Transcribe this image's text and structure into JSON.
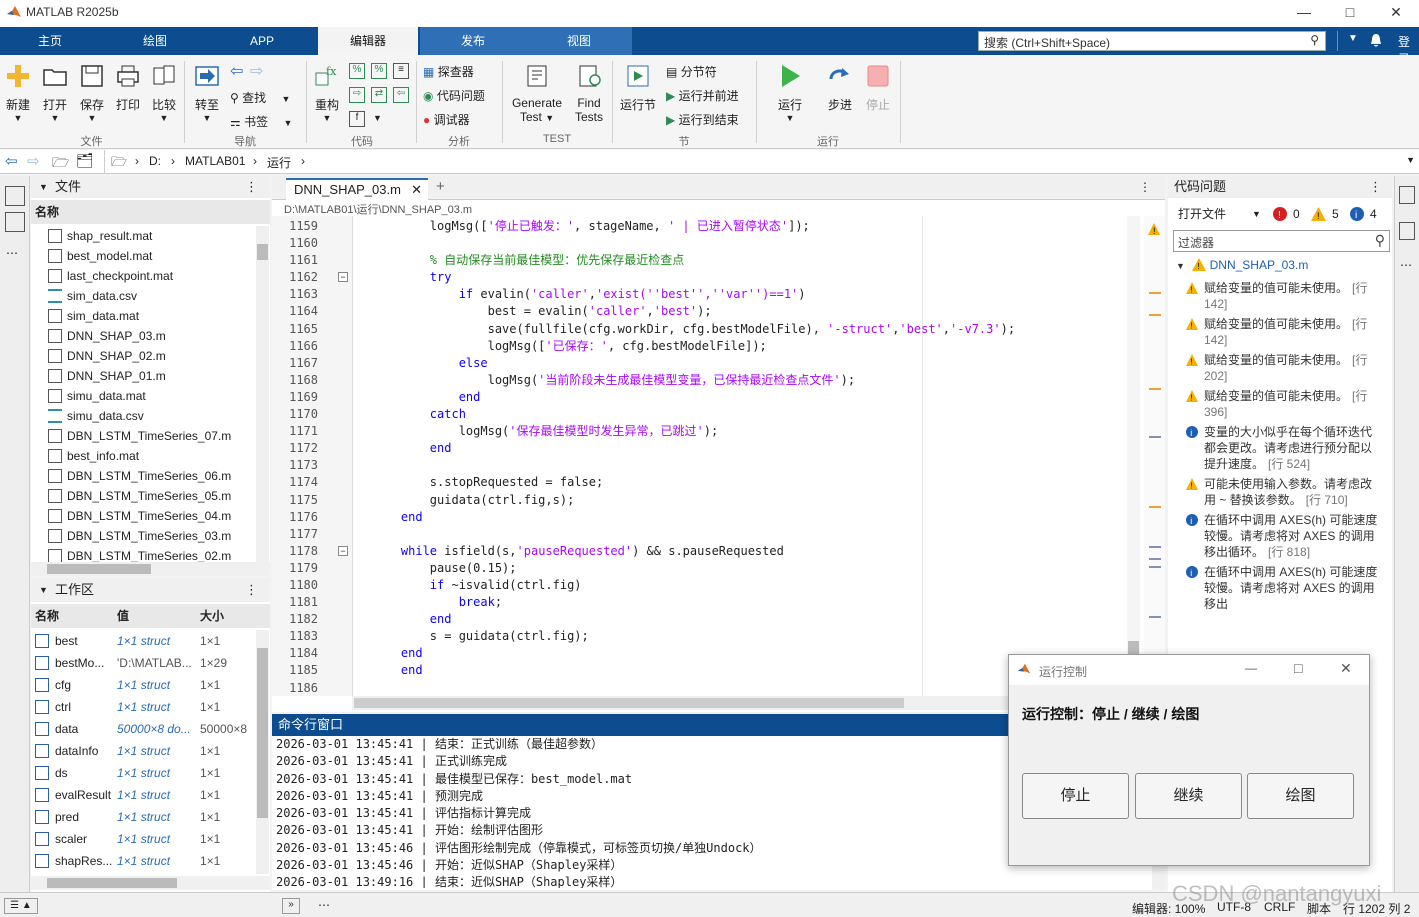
{
  "window": {
    "title": "MATLAB R2025b"
  },
  "tabs": [
    "主页",
    "绘图",
    "APP",
    "编辑器",
    "发布",
    "视图"
  ],
  "search": {
    "placeholder": "搜索 (Ctrl+Shift+Space)"
  },
  "login": "登录",
  "ribbon": {
    "file": {
      "new": "新建",
      "open": "打开",
      "save": "保存",
      "print": "打印",
      "compare": "比较",
      "group": "文件"
    },
    "nav": {
      "goto": "转至",
      "find": "查找",
      "bookmark": "书签",
      "group": "导航"
    },
    "code": {
      "refactor": "重构",
      "group": "代码"
    },
    "analysis": {
      "inspector": "探查器",
      "code_issues": "代码问题",
      "debugger": "调试器",
      "group": "分析"
    },
    "test": {
      "generate": "Generate",
      "generate2": "Test",
      "find": "Find",
      "find2": "Tests",
      "group": "TEST"
    },
    "section": {
      "run_section": "运行节",
      "split": "分节符",
      "run_advance": "运行并前进",
      "run_to_end": "运行到结束",
      "group": "节"
    },
    "run": {
      "run": "运行",
      "step": "步进",
      "stop": "停止",
      "group": "运行"
    }
  },
  "address": {
    "drive": "D:",
    "folder1": "MATLAB01",
    "folder2": "运行"
  },
  "files": {
    "title": "文件",
    "col_name": "名称",
    "items": [
      "shap_result.mat",
      "best_model.mat",
      "last_checkpoint.mat",
      "sim_data.csv",
      "sim_data.mat",
      "DNN_SHAP_03.m",
      "DNN_SHAP_02.m",
      "DNN_SHAP_01.m",
      "simu_data.mat",
      "simu_data.csv",
      "DBN_LSTM_TimeSeries_07.m",
      "best_info.mat",
      "DBN_LSTM_TimeSeries_06.m",
      "DBN_LSTM_TimeSeries_05.m",
      "DBN_LSTM_TimeSeries_04.m",
      "DBN_LSTM_TimeSeries_03.m",
      "DBN_LSTM_TimeSeries_02.m"
    ]
  },
  "workspace": {
    "title": "工作区",
    "col_name": "名称",
    "col_value": "值",
    "col_size": "大小",
    "rows": [
      {
        "name": "best",
        "value": "1×1 struct",
        "size": "1×1"
      },
      {
        "name": "bestMo...",
        "value": "'D:\\MATLAB...",
        "size": "1×29"
      },
      {
        "name": "cfg",
        "value": "1×1 struct",
        "size": "1×1"
      },
      {
        "name": "ctrl",
        "value": "1×1 struct",
        "size": "1×1"
      },
      {
        "name": "data",
        "value": "50000×8 do...",
        "size": "50000×8"
      },
      {
        "name": "dataInfo",
        "value": "1×1 struct",
        "size": "1×1"
      },
      {
        "name": "ds",
        "value": "1×1 struct",
        "size": "1×1"
      },
      {
        "name": "evalResult",
        "value": "1×1 struct",
        "size": "1×1"
      },
      {
        "name": "pred",
        "value": "1×1 struct",
        "size": "1×1"
      },
      {
        "name": "scaler",
        "value": "1×1 struct",
        "size": "1×1"
      },
      {
        "name": "shapRes...",
        "value": "1×1 struct",
        "size": "1×1"
      }
    ]
  },
  "editor": {
    "tab": "DNN_SHAP_03.m",
    "path": "D:\\MATLAB01\\运行\\DNN_SHAP_03.m",
    "lines": [
      {
        "n": "1159",
        "t": [
          [
            "",
            "        logMsg(["
          ],
          [
            "str",
            "'停止已触发：'"
          ],
          [
            "",
            ", stageName, "
          ],
          [
            "str",
            "' | 已进入暂停状态'"
          ],
          [
            "",
            "]);"
          ]
        ]
      },
      {
        "n": "1160",
        "t": [
          [
            "",
            ""
          ]
        ]
      },
      {
        "n": "1161",
        "t": [
          [
            "",
            "        "
          ],
          [
            "cm",
            "% 自动保存当前最佳模型：优先保存最近检查点"
          ]
        ]
      },
      {
        "n": "1162",
        "t": [
          [
            "",
            "        "
          ],
          [
            "kw",
            "try"
          ]
        ]
      },
      {
        "n": "1163",
        "t": [
          [
            "",
            "            "
          ],
          [
            "kw",
            "if"
          ],
          [
            "",
            " evalin("
          ],
          [
            "str",
            "'caller'"
          ],
          [
            "",
            ","
          ],
          [
            "str",
            "'exist(''best'',''var'')==1'"
          ],
          [
            "",
            ")"
          ]
        ]
      },
      {
        "n": "1164",
        "t": [
          [
            "",
            "                best = evalin("
          ],
          [
            "str",
            "'caller'"
          ],
          [
            "",
            ","
          ],
          [
            "str",
            "'best'"
          ],
          [
            "",
            ");"
          ]
        ]
      },
      {
        "n": "1165",
        "t": [
          [
            "",
            "                save(fullfile(cfg.workDir, cfg.bestModelFile), "
          ],
          [
            "str",
            "'-struct'"
          ],
          [
            "",
            ","
          ],
          [
            "str",
            "'best'"
          ],
          [
            "",
            ","
          ],
          [
            "str",
            "'-v7.3'"
          ],
          [
            "",
            ");"
          ]
        ]
      },
      {
        "n": "1166",
        "t": [
          [
            "",
            "                logMsg(["
          ],
          [
            "str",
            "'已保存：'"
          ],
          [
            "",
            ", cfg.bestModelFile]);"
          ]
        ]
      },
      {
        "n": "1167",
        "t": [
          [
            "",
            "            "
          ],
          [
            "kw",
            "else"
          ]
        ]
      },
      {
        "n": "1168",
        "t": [
          [
            "",
            "                logMsg("
          ],
          [
            "str",
            "'当前阶段未生成最佳模型变量，已保持最近检查点文件'"
          ],
          [
            "",
            ");"
          ]
        ]
      },
      {
        "n": "1169",
        "t": [
          [
            "",
            "            "
          ],
          [
            "kw",
            "end"
          ]
        ]
      },
      {
        "n": "1170",
        "t": [
          [
            "",
            "        "
          ],
          [
            "kw",
            "catch"
          ]
        ]
      },
      {
        "n": "1171",
        "t": [
          [
            "",
            "            logMsg("
          ],
          [
            "str",
            "'保存最佳模型时发生异常，已跳过'"
          ],
          [
            "",
            ");"
          ]
        ]
      },
      {
        "n": "1172",
        "t": [
          [
            "",
            "        "
          ],
          [
            "kw",
            "end"
          ]
        ]
      },
      {
        "n": "1173",
        "t": [
          [
            "",
            ""
          ]
        ]
      },
      {
        "n": "1174",
        "t": [
          [
            "",
            "        s.stopRequested = false;"
          ]
        ]
      },
      {
        "n": "1175",
        "t": [
          [
            "",
            "        guidata(ctrl.fig,s);"
          ]
        ]
      },
      {
        "n": "1176",
        "t": [
          [
            "",
            "    "
          ],
          [
            "kw",
            "end"
          ]
        ]
      },
      {
        "n": "1177",
        "t": [
          [
            "",
            ""
          ]
        ]
      },
      {
        "n": "1178",
        "t": [
          [
            "",
            "    "
          ],
          [
            "kw",
            "while"
          ],
          [
            "",
            " isfield(s,"
          ],
          [
            "str",
            "'pauseRequested'"
          ],
          [
            "",
            ") && s.pauseRequested"
          ]
        ]
      },
      {
        "n": "1179",
        "t": [
          [
            "",
            "        pause(0.15);"
          ]
        ]
      },
      {
        "n": "1180",
        "t": [
          [
            "",
            "        "
          ],
          [
            "kw",
            "if"
          ],
          [
            "",
            " ~isvalid(ctrl.fig)"
          ]
        ]
      },
      {
        "n": "1181",
        "t": [
          [
            "",
            "            "
          ],
          [
            "kw",
            "break"
          ],
          [
            "",
            ";"
          ]
        ]
      },
      {
        "n": "1182",
        "t": [
          [
            "",
            "        "
          ],
          [
            "kw",
            "end"
          ]
        ]
      },
      {
        "n": "1183",
        "t": [
          [
            "",
            "        s = guidata(ctrl.fig);"
          ]
        ]
      },
      {
        "n": "1184",
        "t": [
          [
            "",
            "    "
          ],
          [
            "kw",
            "end"
          ]
        ]
      },
      {
        "n": "1185",
        "t": [
          [
            "",
            "    "
          ],
          [
            "kw",
            "end"
          ]
        ]
      },
      {
        "n": "1186",
        "t": [
          [
            "",
            ""
          ]
        ]
      }
    ]
  },
  "command": {
    "title": "命令行窗口",
    "lines": [
      "2026-03-01 13:45:41 | 结束：正式训练（最佳超参数）",
      "2026-03-01 13:45:41 | 正式训练完成",
      "2026-03-01 13:45:41 | 最佳模型已保存：best_model.mat",
      "2026-03-01 13:45:41 | 预测完成",
      "2026-03-01 13:45:41 | 评估指标计算完成",
      "2026-03-01 13:45:41 | 开始：绘制评估图形",
      "2026-03-01 13:45:46 | 评估图形绘制完成（停靠模式，可标签页切换/单独Undock）",
      "2026-03-01 13:45:46 | 开始：近似SHAP（Shapley采样）",
      "2026-03-01 13:49:16 | 结束：近似SHAP（Shapley采样）"
    ]
  },
  "issues": {
    "title": "代码问题",
    "scope": "打开文件",
    "errors": "0",
    "warnings": "5",
    "infos": "4",
    "filter_placeholder": "过滤器",
    "file": "DNN_SHAP_03.m",
    "items": [
      {
        "type": "warn",
        "text": "赋给变量的值可能未使用。",
        "line": "[行 142]"
      },
      {
        "type": "warn",
        "text": "赋给变量的值可能未使用。",
        "line": "[行 142]"
      },
      {
        "type": "warn",
        "text": "赋给变量的值可能未使用。",
        "line": "[行 202]"
      },
      {
        "type": "warn",
        "text": "赋给变量的值可能未使用。",
        "line": "[行 396]"
      },
      {
        "type": "info",
        "text": "变量的大小似乎在每个循环迭代都会更改。请考虑进行预分配以提升速度。",
        "line": "[行 524]"
      },
      {
        "type": "warn",
        "text": "可能未使用输入参数。请考虑改用 ~ 替换该参数。",
        "line": "[行 710]"
      },
      {
        "type": "info",
        "text": "在循环中调用 AXES(h) 可能速度较慢。请考虑将对 AXES 的调用移出循环。",
        "line": "[行 818]"
      },
      {
        "type": "info",
        "text": "在循环中调用 AXES(h) 可能速度较慢。请考虑将对 AXES 的调用移出",
        "line": ""
      }
    ]
  },
  "dialog": {
    "title": "运行控制",
    "heading": "运行控制：停止 / 继续 / 绘图",
    "stop": "停止",
    "resume": "继续",
    "plot": "绘图"
  },
  "status": {
    "zoom": "编辑器: 100%",
    "encoding": "UTF-8",
    "eol": "CRLF",
    "type": "脚本",
    "pos": "行 1202  列 2"
  },
  "watermark": "CSDN @nantangyuxi"
}
